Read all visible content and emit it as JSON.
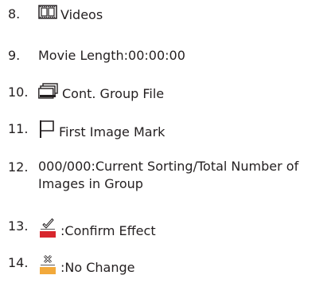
{
  "items": [
    {
      "number": "8.",
      "icon": "video-frames-icon",
      "text": "Videos"
    },
    {
      "number": "9.",
      "text": "Movie Length:00:00:00"
    },
    {
      "number": "10.",
      "icon": "stacked-files-icon",
      "text": "Cont. Group File"
    },
    {
      "number": "11.",
      "icon": "flag-icon",
      "text": "First Image Mark"
    },
    {
      "number": "12.",
      "text": "000/000:Current Sorting/Total Number of Images in Group"
    },
    {
      "number": "13.",
      "icon": "checkmark-red-icon",
      "text": ":Confirm Effect"
    },
    {
      "number": "14.",
      "icon": "cross-orange-icon",
      "text": ":No Change"
    }
  ],
  "colors": {
    "text": "#231f20",
    "confirm_bar": "#d7262d",
    "nochange_bar": "#f2a93b"
  }
}
